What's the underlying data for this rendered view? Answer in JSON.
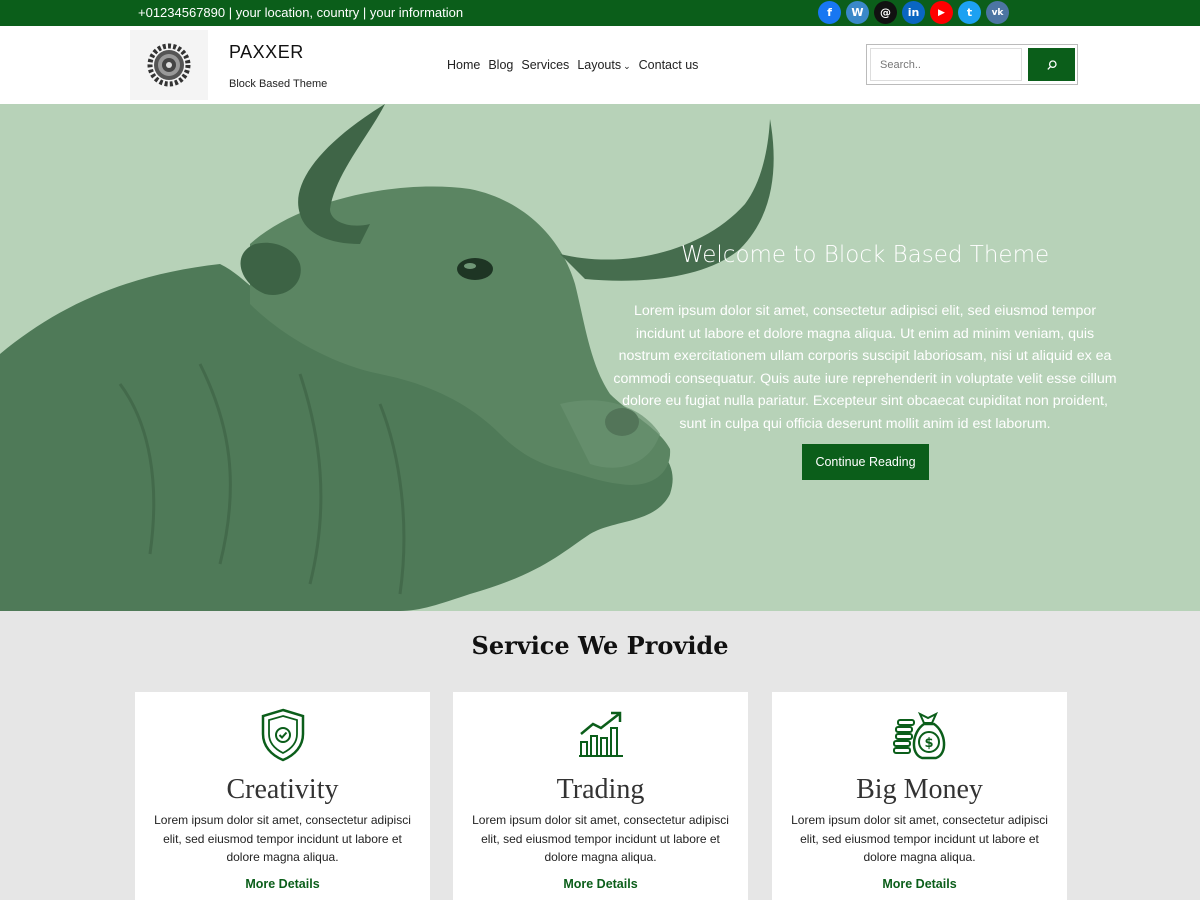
{
  "topbar": {
    "info": "+01234567890 | your location, country | your information",
    "socials": [
      {
        "icon": "facebook-icon",
        "glyph": "f",
        "color": "#1877f2"
      },
      {
        "icon": "wordpress-icon",
        "glyph": "W",
        "color": "#3a88c9"
      },
      {
        "icon": "threads-icon",
        "glyph": "@",
        "color": "#111111"
      },
      {
        "icon": "linkedin-icon",
        "glyph": "in",
        "color": "#0a66c2"
      },
      {
        "icon": "youtube-icon",
        "glyph": "▶",
        "color": "#ff0000"
      },
      {
        "icon": "twitter-icon",
        "glyph": "t",
        "color": "#1da1f2"
      },
      {
        "icon": "vk-icon",
        "glyph": "vk",
        "color": "#4c75a3"
      }
    ]
  },
  "header": {
    "title": "PAXXER",
    "tagline": "Block Based Theme",
    "nav": [
      "Home",
      "Blog",
      "Services",
      "Layouts",
      "Contact us"
    ],
    "search_placeholder": "Search.."
  },
  "hero": {
    "title": "Welcome to Block Based Theme",
    "text": "Lorem ipsum dolor sit amet, consectetur adipisci elit, sed eiusmod tempor incidunt ut labore et dolore magna aliqua. Ut enim ad minim veniam, quis nostrum exercitationem ullam corporis suscipit laboriosam, nisi ut aliquid ex ea commodi consequatur. Quis aute iure reprehenderit in voluptate velit esse cillum dolore eu fugiat nulla pariatur. Excepteur sint obcaecat cupiditat non proident, sunt in culpa qui officia deserunt mollit anim id est laborum.",
    "button": "Continue Reading"
  },
  "services": {
    "heading": "Service We Provide",
    "cards": [
      {
        "title": "Creativity",
        "text": "Lorem ipsum dolor sit amet, consectetur adipisci elit, sed eiusmod tempor incidunt ut labore et dolore magna aliqua.",
        "link": "More Details",
        "icon": "shield-check-icon"
      },
      {
        "title": "Trading",
        "text": "Lorem ipsum dolor sit amet, consectetur adipisci elit, sed eiusmod tempor incidunt ut labore et dolore magna aliqua.",
        "link": "More Details",
        "icon": "chart-growth-icon"
      },
      {
        "title": "Big Money",
        "text": "Lorem ipsum dolor sit amet, consectetur adipisci elit, sed eiusmod tempor incidunt ut labore et dolore magna aliqua.",
        "link": "More Details",
        "icon": "money-bag-icon"
      }
    ]
  },
  "colors": {
    "brand": "#0b5e1a",
    "hero_bg": "#b7d2b8",
    "section_bg": "#e6e6e6"
  }
}
